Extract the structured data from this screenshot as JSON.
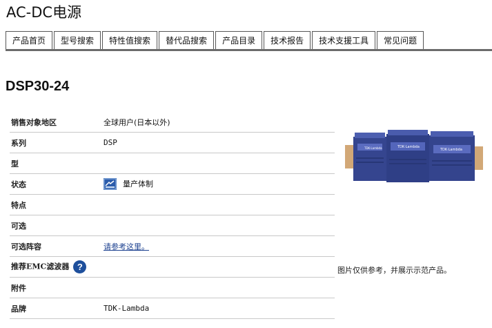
{
  "page_title": "AC-DC电源",
  "tabs": [
    {
      "label": "产品首页"
    },
    {
      "label": "型号搜索"
    },
    {
      "label": "特性值搜索"
    },
    {
      "label": "替代品搜索"
    },
    {
      "label": "产品目录"
    },
    {
      "label": "技术报告"
    },
    {
      "label": "技术支援工具"
    },
    {
      "label": "常见问题"
    }
  ],
  "model_name": "DSP30-24",
  "spec_rows": [
    {
      "key": "销售对象地区",
      "value": "全球用户(日本以外)"
    },
    {
      "key": "系列",
      "value": "DSP"
    },
    {
      "key": "型",
      "value": ""
    },
    {
      "key": "状态",
      "value": "量产体制"
    },
    {
      "key": "特点",
      "value": ""
    },
    {
      "key": "可选",
      "value": ""
    },
    {
      "key": "可选阵容",
      "value": "请参考这里。"
    },
    {
      "key": "推荐EMC滤波器",
      "value": ""
    },
    {
      "key": "附件",
      "value": ""
    },
    {
      "key": "品牌",
      "value": "TDK-Lambda"
    }
  ],
  "icons": {
    "status": "mass-production-icon",
    "help": "help-icon",
    "help_glyph": "?"
  },
  "product_image": {
    "module_labels": [
      "TDK·Lambda",
      "TDK·Lambda",
      "TDK·Lambda"
    ],
    "colors": {
      "body": "#3b4a9a",
      "rail": "#c9a06b"
    }
  },
  "image_caption": "图片仅供参考，并展示示范产品。"
}
